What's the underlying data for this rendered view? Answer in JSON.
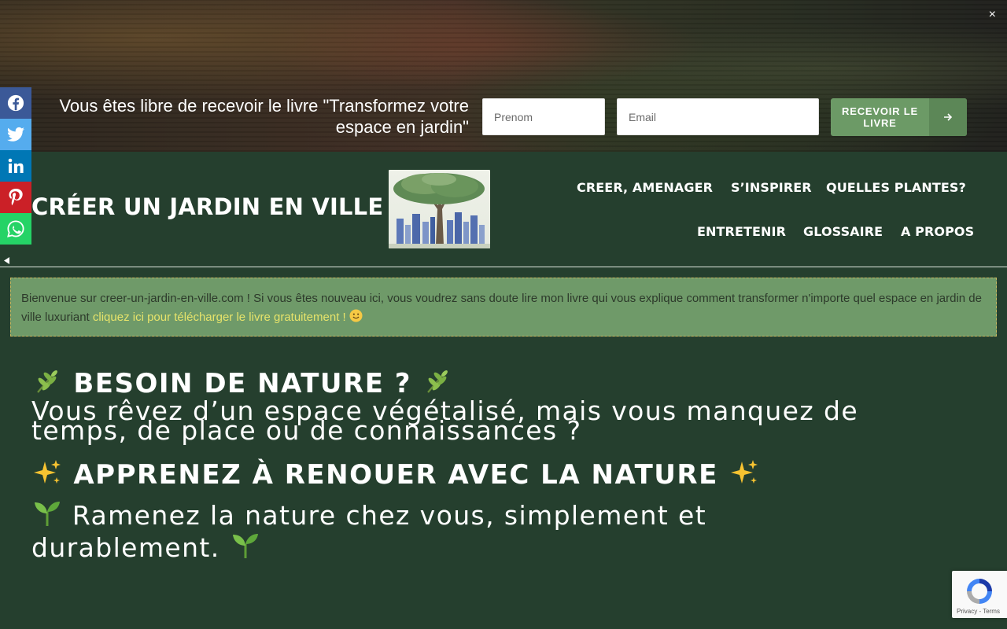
{
  "optin": {
    "text": "Vous êtes libre de recevoir le livre \"Transformez votre espace en jardin\"",
    "firstname_placeholder": "Prenom",
    "email_placeholder": "Email",
    "submit_label": "RECEVOIR LE LIVRE",
    "close_symbol": "×"
  },
  "social": [
    {
      "name": "facebook-icon",
      "color": "#3b5998"
    },
    {
      "name": "twitter-icon",
      "color": "#55acee"
    },
    {
      "name": "linkedin-icon",
      "color": "#0077b5"
    },
    {
      "name": "pinterest-icon",
      "color": "#cb2027"
    },
    {
      "name": "whatsapp-icon",
      "color": "#25d366"
    }
  ],
  "header": {
    "site_title": "CRÉER UN JARDIN EN VILLE",
    "nav": [
      "CREER, AMENAGER",
      "S’INSPIRER",
      "QUELLES PLANTES?",
      "ENTRETENIR",
      "GLOSSAIRE",
      "A PROPOS"
    ]
  },
  "notice": {
    "text": "Bienvenue sur creer-un-jardin-en-ville.com ! Si vous êtes nouveau ici, vous voudrez sans doute lire mon livre qui vous explique comment transformer n'importe quel espace en jardin de ville luxuriant ",
    "link": "cliquez ici pour télécharger le livre gratuitement !"
  },
  "hero": {
    "heading1": "BESOIN DE NATURE ?",
    "paragraph1": "Vous rêvez d’un espace végétalisé, mais vous manquez de temps, de place ou de connaissances ?",
    "heading2": "APPRENEZ À RENOUER AVEC LA NATURE",
    "paragraph2": "Ramenez la nature chez vous, simplement et durablement."
  },
  "recaptcha": {
    "links": "Privacy - Terms"
  },
  "colors": {
    "background": "#253f2e",
    "notice_bg": "#6f9a69",
    "link": "#e6e36a",
    "button": "#6c9a66"
  }
}
